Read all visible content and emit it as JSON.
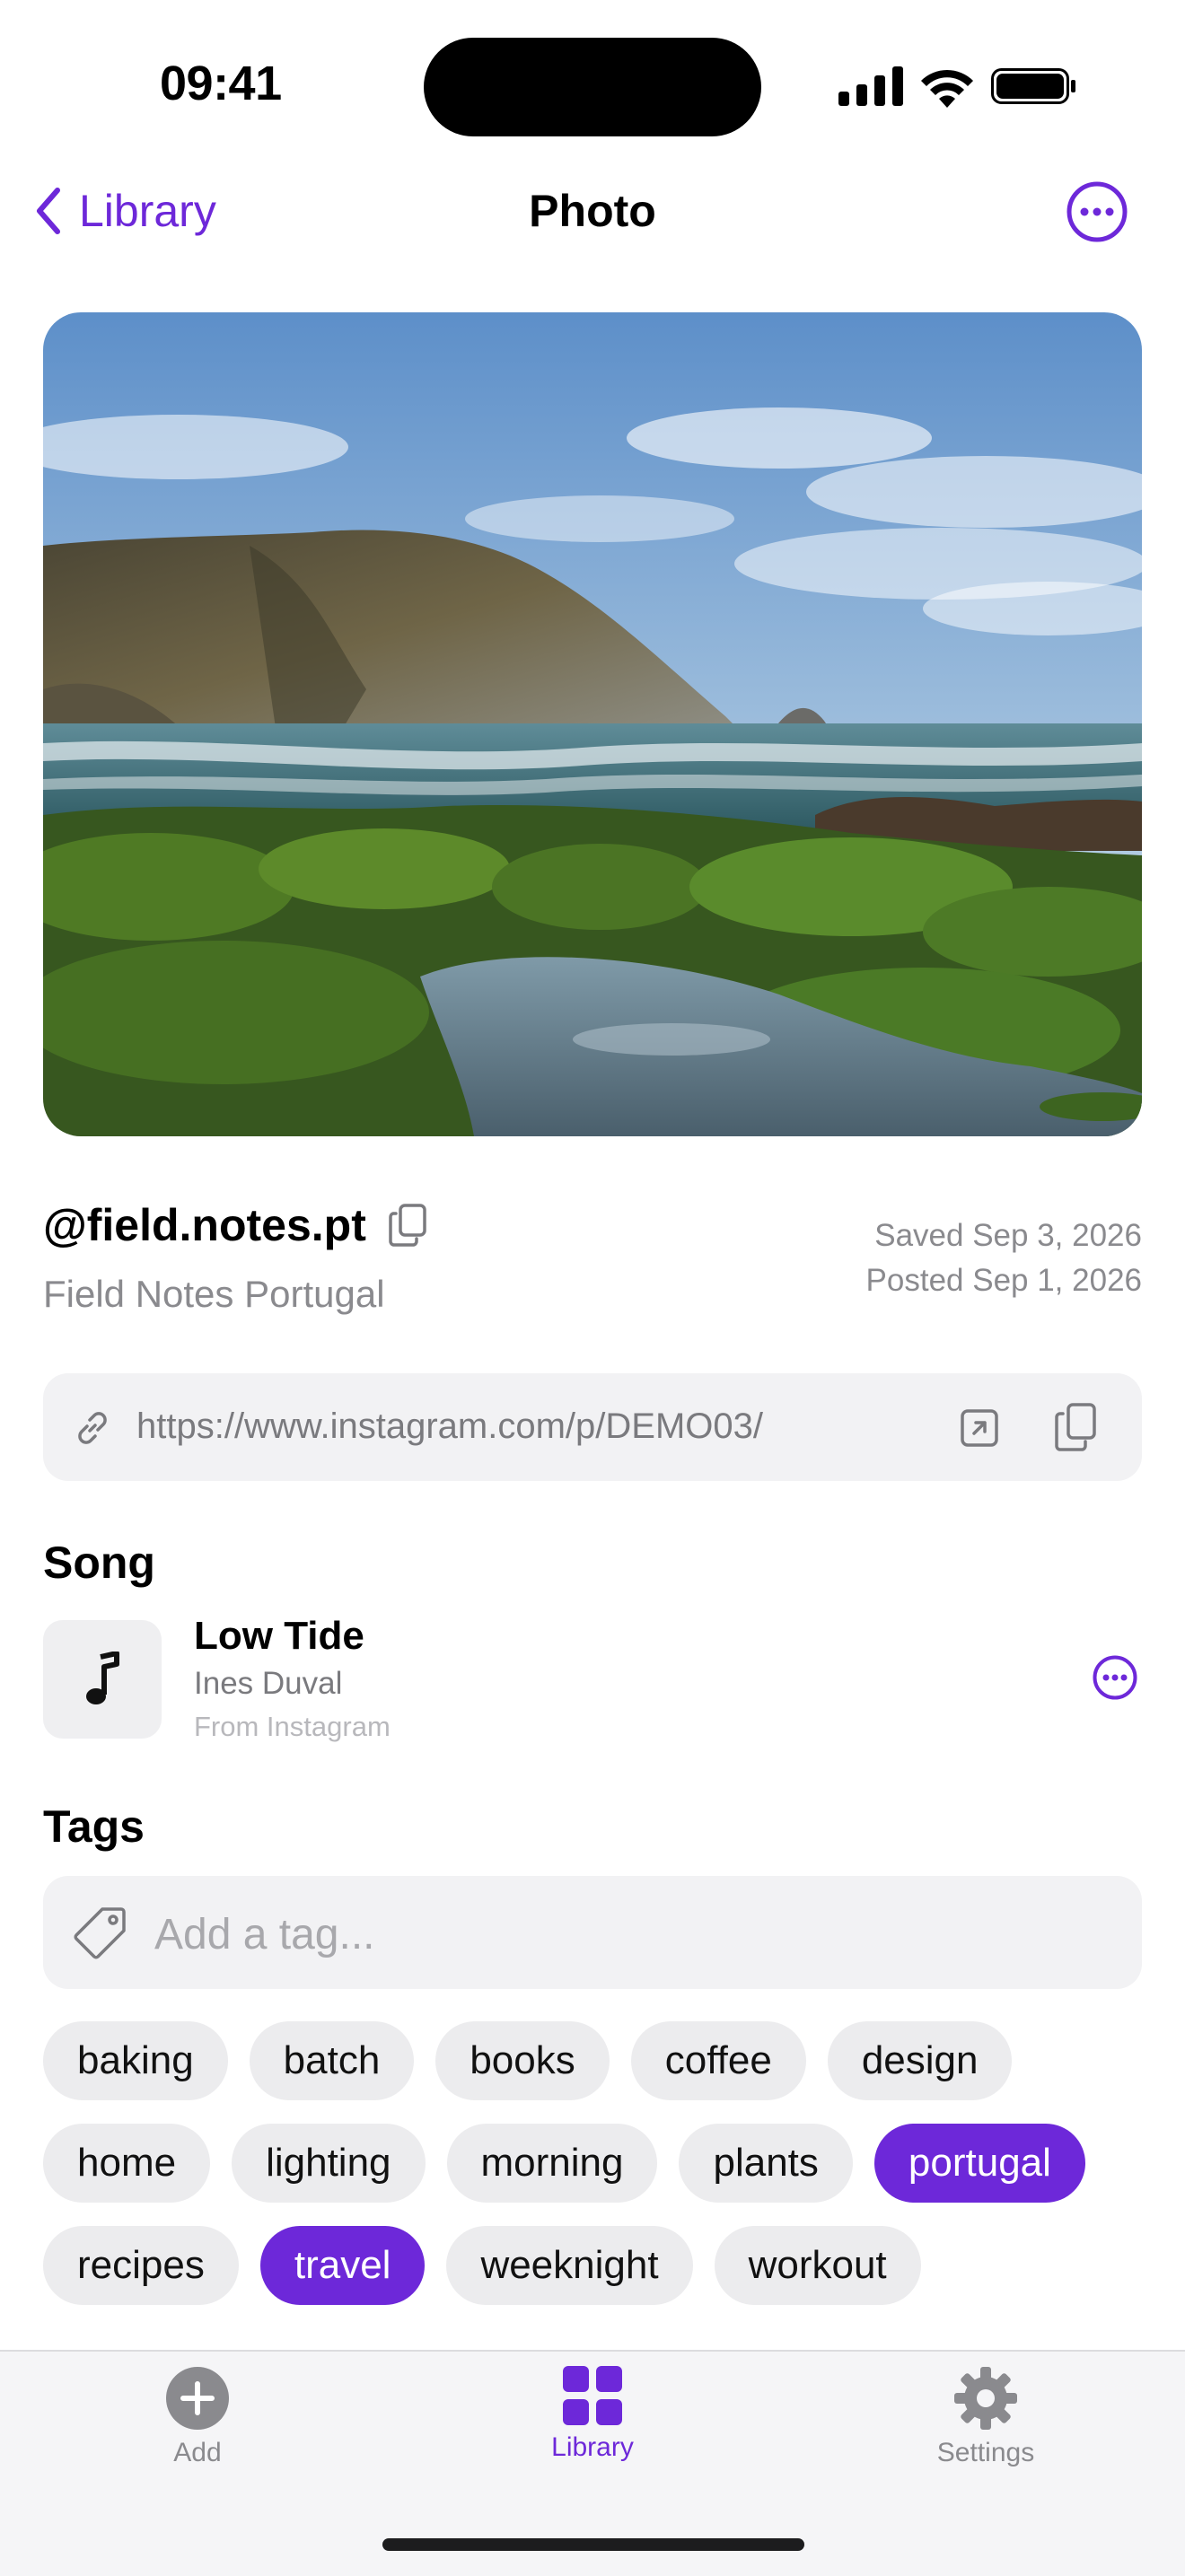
{
  "status_bar": {
    "time": "09:41"
  },
  "nav": {
    "back_label": "Library",
    "title": "Photo"
  },
  "post": {
    "handle": "@field.notes.pt",
    "display_name": "Field Notes Portugal",
    "saved": "Saved Sep 3, 2026",
    "posted": "Posted Sep 1, 2026",
    "url": "https://www.instagram.com/p/DEMO03/"
  },
  "song": {
    "section_title": "Song",
    "title": "Low Tide",
    "artist": "Ines Duval",
    "source": "From Instagram"
  },
  "tags": {
    "section_title": "Tags",
    "placeholder": "Add a tag...",
    "rows": [
      [
        {
          "label": "baking",
          "selected": false
        },
        {
          "label": "batch",
          "selected": false
        },
        {
          "label": "books",
          "selected": false
        },
        {
          "label": "coffee",
          "selected": false
        },
        {
          "label": "design",
          "selected": false
        }
      ],
      [
        {
          "label": "home",
          "selected": false
        },
        {
          "label": "lighting",
          "selected": false
        },
        {
          "label": "morning",
          "selected": false
        },
        {
          "label": "plants",
          "selected": false
        },
        {
          "label": "portugal",
          "selected": true
        }
      ],
      [
        {
          "label": "recipes",
          "selected": false
        },
        {
          "label": "travel",
          "selected": true
        },
        {
          "label": "weeknight",
          "selected": false
        },
        {
          "label": "workout",
          "selected": false
        }
      ]
    ]
  },
  "tab_bar": {
    "items": [
      {
        "label": "Add",
        "icon": "plus-circle-icon",
        "active": false
      },
      {
        "label": "Library",
        "icon": "grid-icon",
        "active": true
      },
      {
        "label": "Settings",
        "icon": "gear-icon",
        "active": false
      }
    ]
  },
  "colors": {
    "accent": "#6d28d9",
    "secondary_text": "#8a8a8e",
    "field_background": "#f2f2f4"
  }
}
